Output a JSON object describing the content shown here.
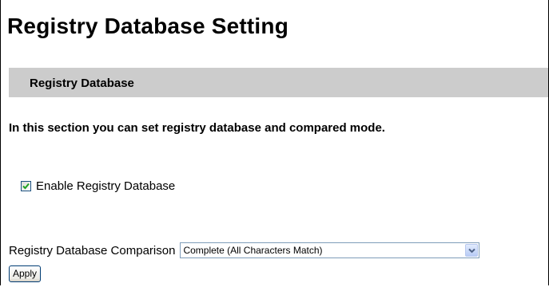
{
  "page": {
    "title": "Registry Database Setting"
  },
  "section": {
    "header": "Registry Database",
    "description": "In this section you can set registry database and compared mode."
  },
  "enable_registry": {
    "label": "Enable Registry Database",
    "checked": true
  },
  "comparison": {
    "label": "Registry Database Comparison",
    "selected": "Complete (All Characters Match)"
  },
  "apply": {
    "label": "Apply"
  },
  "icons": {
    "checkbox_mark": "checkmark-icon",
    "dropdown": "chevron-down-icon"
  },
  "colors": {
    "section_header_bg": "#cccccc",
    "checkmark": "#21a121",
    "select_border": "#7f9db9"
  }
}
